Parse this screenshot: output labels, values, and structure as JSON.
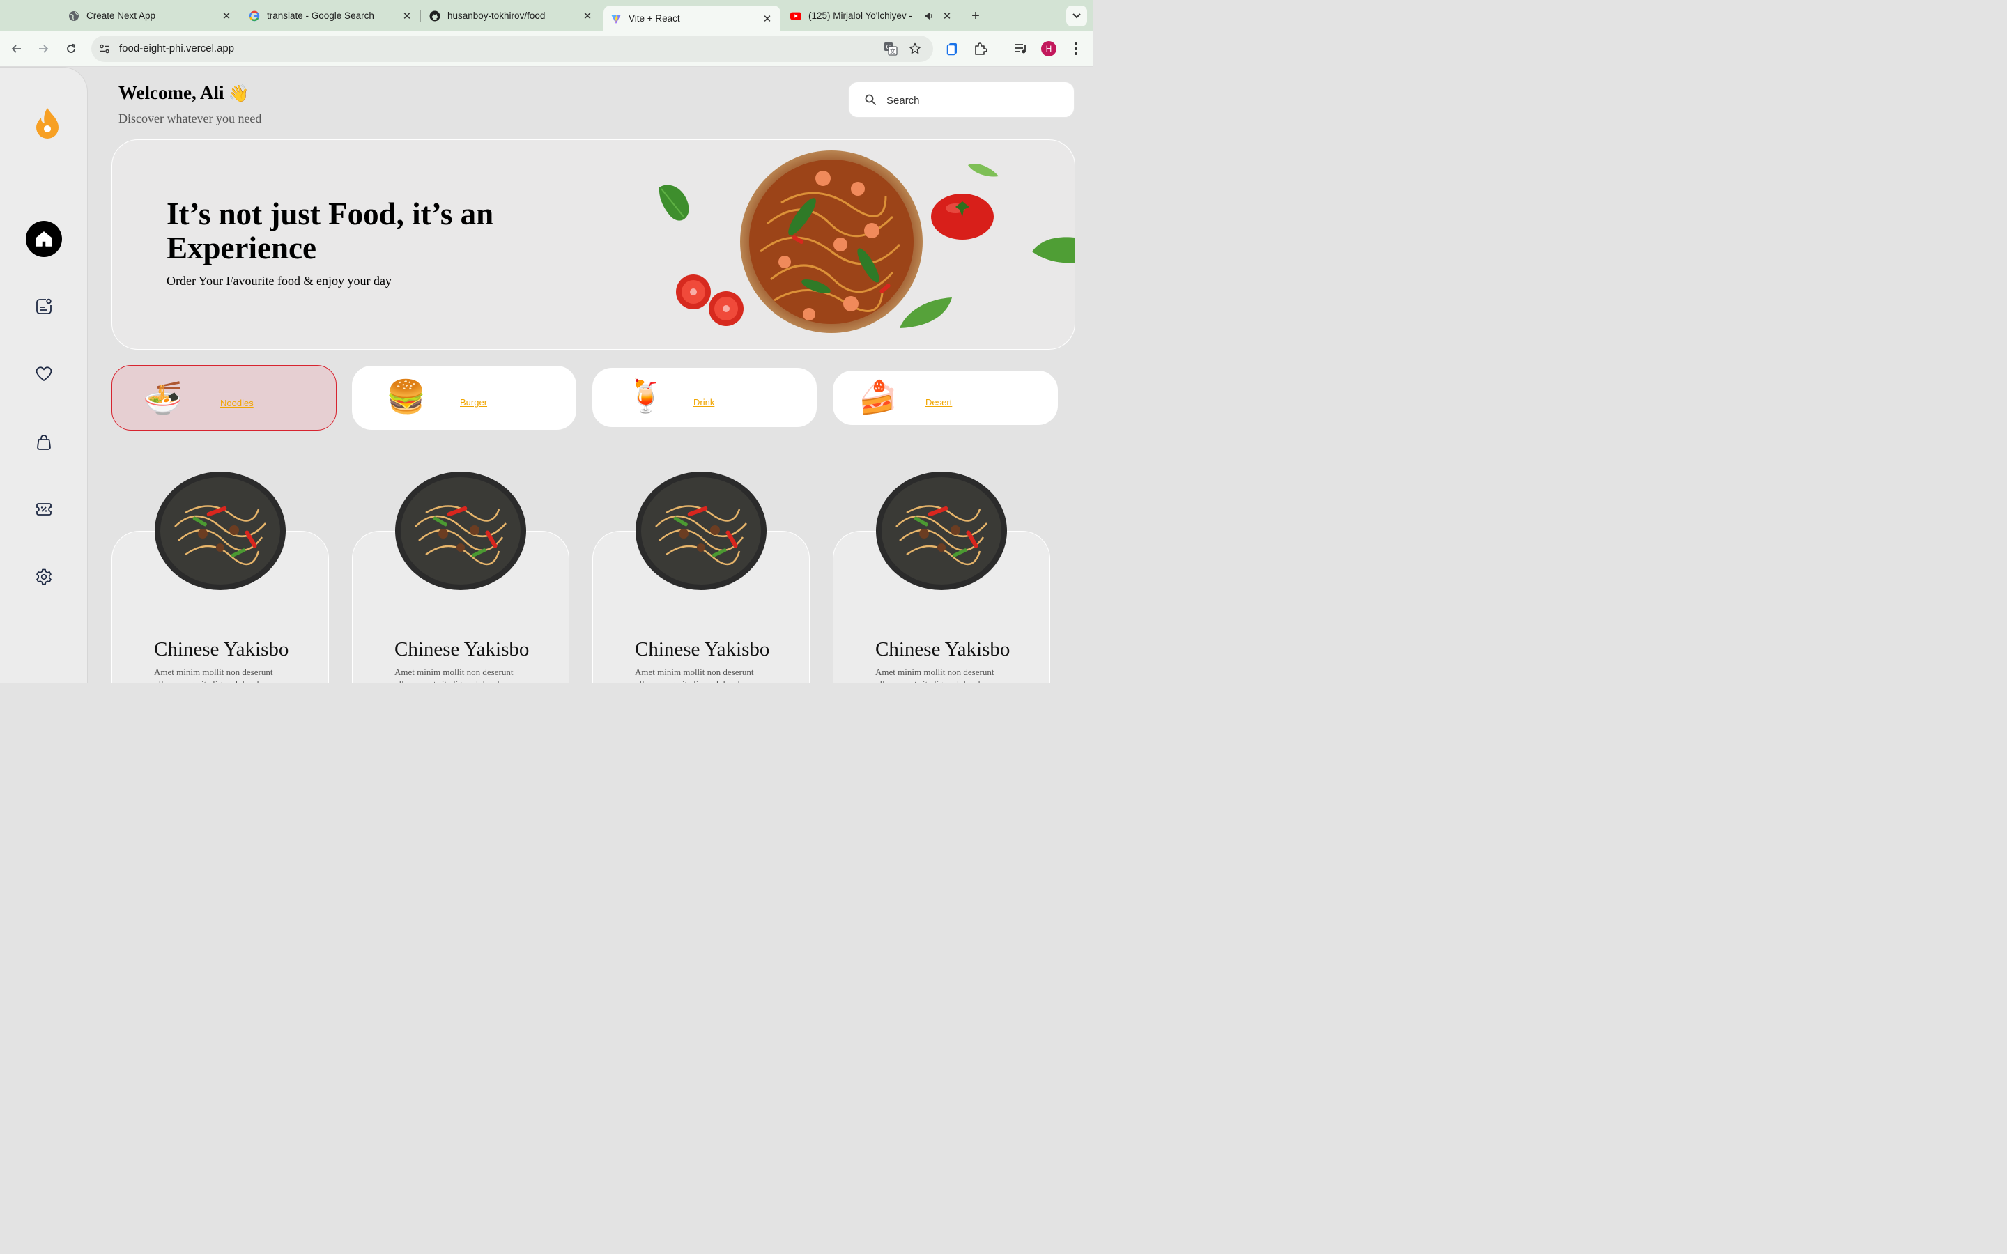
{
  "browser": {
    "tabs": [
      {
        "title": "Create Next App",
        "icon": "globe-icon"
      },
      {
        "title": "translate - Google Search",
        "icon": "google-icon"
      },
      {
        "title": "husanboy-tokhirov/food",
        "icon": "github-icon"
      },
      {
        "title": "Vite + React",
        "icon": "vite-icon",
        "active": true
      },
      {
        "title": "(125) Mirjalol Yo'lchiyev -",
        "icon": "youtube-icon"
      }
    ],
    "url": "food-eight-phi.vercel.app",
    "profile_initial": "H"
  },
  "header": {
    "welcome": "Welcome, Ali",
    "wave": "👋",
    "subtitle": "Discover whatever you need",
    "search_placeholder": "Search"
  },
  "sidebar": {
    "items": [
      {
        "name": "home",
        "icon": "home-icon",
        "active": true
      },
      {
        "name": "orders",
        "icon": "note-icon"
      },
      {
        "name": "favorites",
        "icon": "heart-icon"
      },
      {
        "name": "cart",
        "icon": "bag-icon"
      },
      {
        "name": "discounts",
        "icon": "discount-icon"
      },
      {
        "name": "settings",
        "icon": "gear-icon"
      }
    ]
  },
  "hero": {
    "title": "It’s not just Food, it’s an Experience",
    "subtitle": "Order Your Favourite food & enjoy your day"
  },
  "categories": [
    {
      "label": "Noodles",
      "emoji": "🍜",
      "active": true
    },
    {
      "label": "Burger",
      "emoji": "🍔"
    },
    {
      "label": "Drink",
      "emoji": "🍹"
    },
    {
      "label": "Desert",
      "emoji": "🍰"
    }
  ],
  "products": [
    {
      "title": "Chinese Yakisbo",
      "description": "Amet minim mollit non deserunt ullamco est sit aliqua dolor do"
    },
    {
      "title": "Chinese Yakisbo",
      "description": "Amet minim mollit non deserunt ullamco est sit aliqua dolor do"
    },
    {
      "title": "Chinese Yakisbo",
      "description": "Amet minim mollit non deserunt ullamco est sit aliqua dolor do"
    },
    {
      "title": "Chinese Yakisbo",
      "description": "Amet minim mollit non deserunt ullamco est sit aliqua dolor do"
    }
  ],
  "colors": {
    "accent": "#f0a500",
    "active_category_border": "#d7242f",
    "active_category_bg": "#e6cfd2",
    "flame": "#f7a024"
  }
}
